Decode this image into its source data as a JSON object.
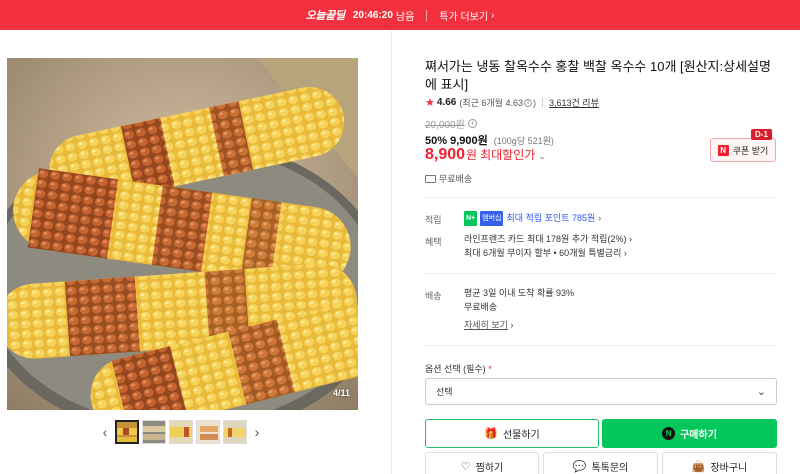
{
  "banner": {
    "logo": "오늘끝딜",
    "timer": "20:46:20",
    "timer_suffix": "남음",
    "more_label": "특가 더보기",
    "background": "#f3303d"
  },
  "gallery": {
    "counter": "4/11",
    "thumb_count": 5,
    "active_thumb": 1
  },
  "product": {
    "title": "쪄서가는 냉동 찰옥수수 홍찰 백찰 옥수수 10개 [원산지:상세설명에 표시]",
    "rating": {
      "score": "4.66",
      "recent": "(최근 6개월 4.63",
      "recent_close": ")",
      "reviews": "3,613건 리뷰"
    },
    "original_price": "20,000원",
    "sale": "50% 9,900원",
    "unit_price": "(100g당 521원)",
    "max_price_num": "8,900",
    "max_price_won": "원",
    "max_price_label": "최대할인가",
    "coupon_label": "쿠폰 받기",
    "dday": "D-1",
    "free_shipping_tag": "무료배송"
  },
  "benefits": {
    "points_label": "적립",
    "points_badge": "N+",
    "points_badge2": "멤버십",
    "points_text": "최대 적립 포인트 785원",
    "benefit_label": "혜택",
    "benefit_line1": "라인프렌즈 카드 최대 178원 추가 적립(2%)",
    "benefit_line2": "최대 6개월 무이자 할부 • 60개월 특별금리"
  },
  "shipping": {
    "label": "배송",
    "line1": "평균 3일 이내 도착 확률 93%",
    "line2": "무료배송",
    "details_link": "자세히 보기"
  },
  "options": {
    "label": "옵션 선택 (필수)",
    "required_mark": "*",
    "select_value": "선택"
  },
  "actions": {
    "gift": "선물하기",
    "buy": "구매하기",
    "wish": "찜하기",
    "talk": "톡톡문의",
    "cart": "장바구니"
  },
  "colors": {
    "accent_red": "#f0202f",
    "naver_green": "#03c75a",
    "points_blue": "#2c53f0"
  }
}
